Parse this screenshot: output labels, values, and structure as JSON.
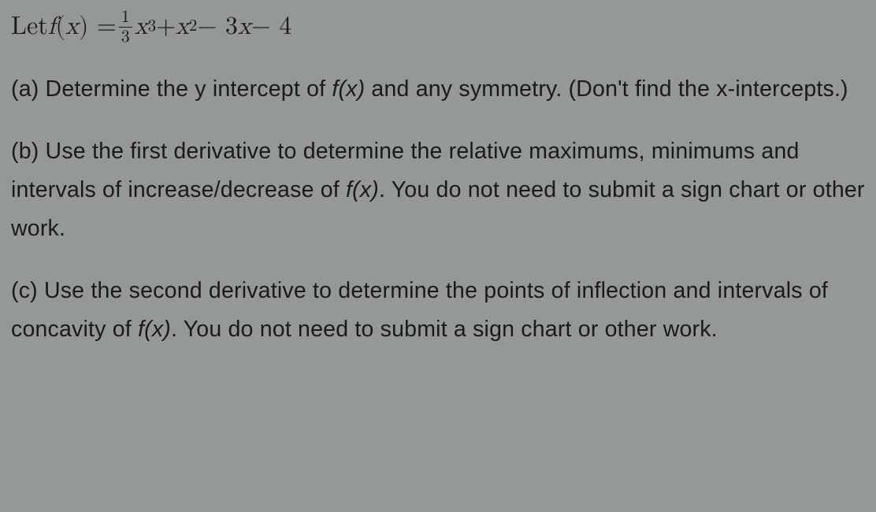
{
  "equation": {
    "prefix": "Let ",
    "lhs_f": "f",
    "lhs_open": " (",
    "lhs_x": "x",
    "lhs_close": ") = ",
    "frac_num": "1",
    "frac_den": "3",
    "term1_var": "x",
    "term1_exp": "3",
    "plus": " + ",
    "term2_var": "x",
    "term2_exp": "2",
    "minus1": " − 3",
    "term3_var": "x",
    "minus2": " − 4"
  },
  "parts": {
    "a": {
      "label": "(a)  Determine the y intercept of ",
      "fx": "f(x)",
      "after_fx": " and any symmetry.  (Don't find the x-intercepts.)"
    },
    "b": {
      "label": "(b)  Use the first derivative to determine the relative maximums, minimums and intervals of increase/decrease of ",
      "fx": "f(x)",
      "after_fx": ".  You do not need to submit a sign chart or other work."
    },
    "c": {
      "label": "(c)  Use the second derivative to determine the points of inflection and intervals of concavity of ",
      "fx": "f(x)",
      "after_fx": ".  You do not need to submit a sign chart or other work."
    }
  }
}
